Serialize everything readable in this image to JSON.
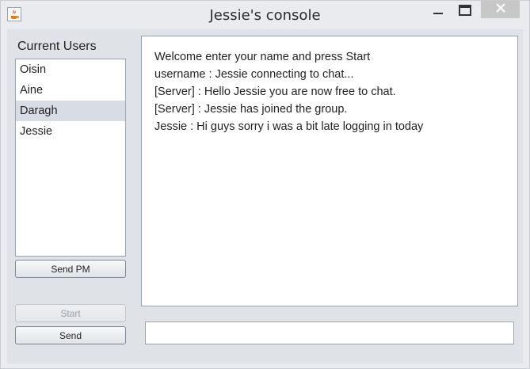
{
  "window": {
    "title": "Jessie's console",
    "app_icon": "java-icon",
    "controls": [
      "minimize-icon",
      "maximize-icon",
      "close-icon"
    ]
  },
  "users": {
    "label": "Current Users",
    "items": [
      {
        "name": "Oisin",
        "selected": false
      },
      {
        "name": "Aine",
        "selected": false
      },
      {
        "name": "Daragh",
        "selected": true
      },
      {
        "name": "Jessie",
        "selected": false
      }
    ],
    "send_pm_label": "Send PM"
  },
  "actions": {
    "start_label": "Start",
    "start_enabled": false,
    "send_label": "Send"
  },
  "chat": {
    "lines": [
      "Welcome enter your name and press Start",
      "username : Jessie connecting to chat...",
      "[Server] : Hello Jessie you are now free to chat.",
      "[Server] : Jessie has joined the group.",
      "Jessie : Hi guys sorry i was a bit late logging in today"
    ]
  },
  "message_input": {
    "value": "",
    "placeholder": ""
  }
}
